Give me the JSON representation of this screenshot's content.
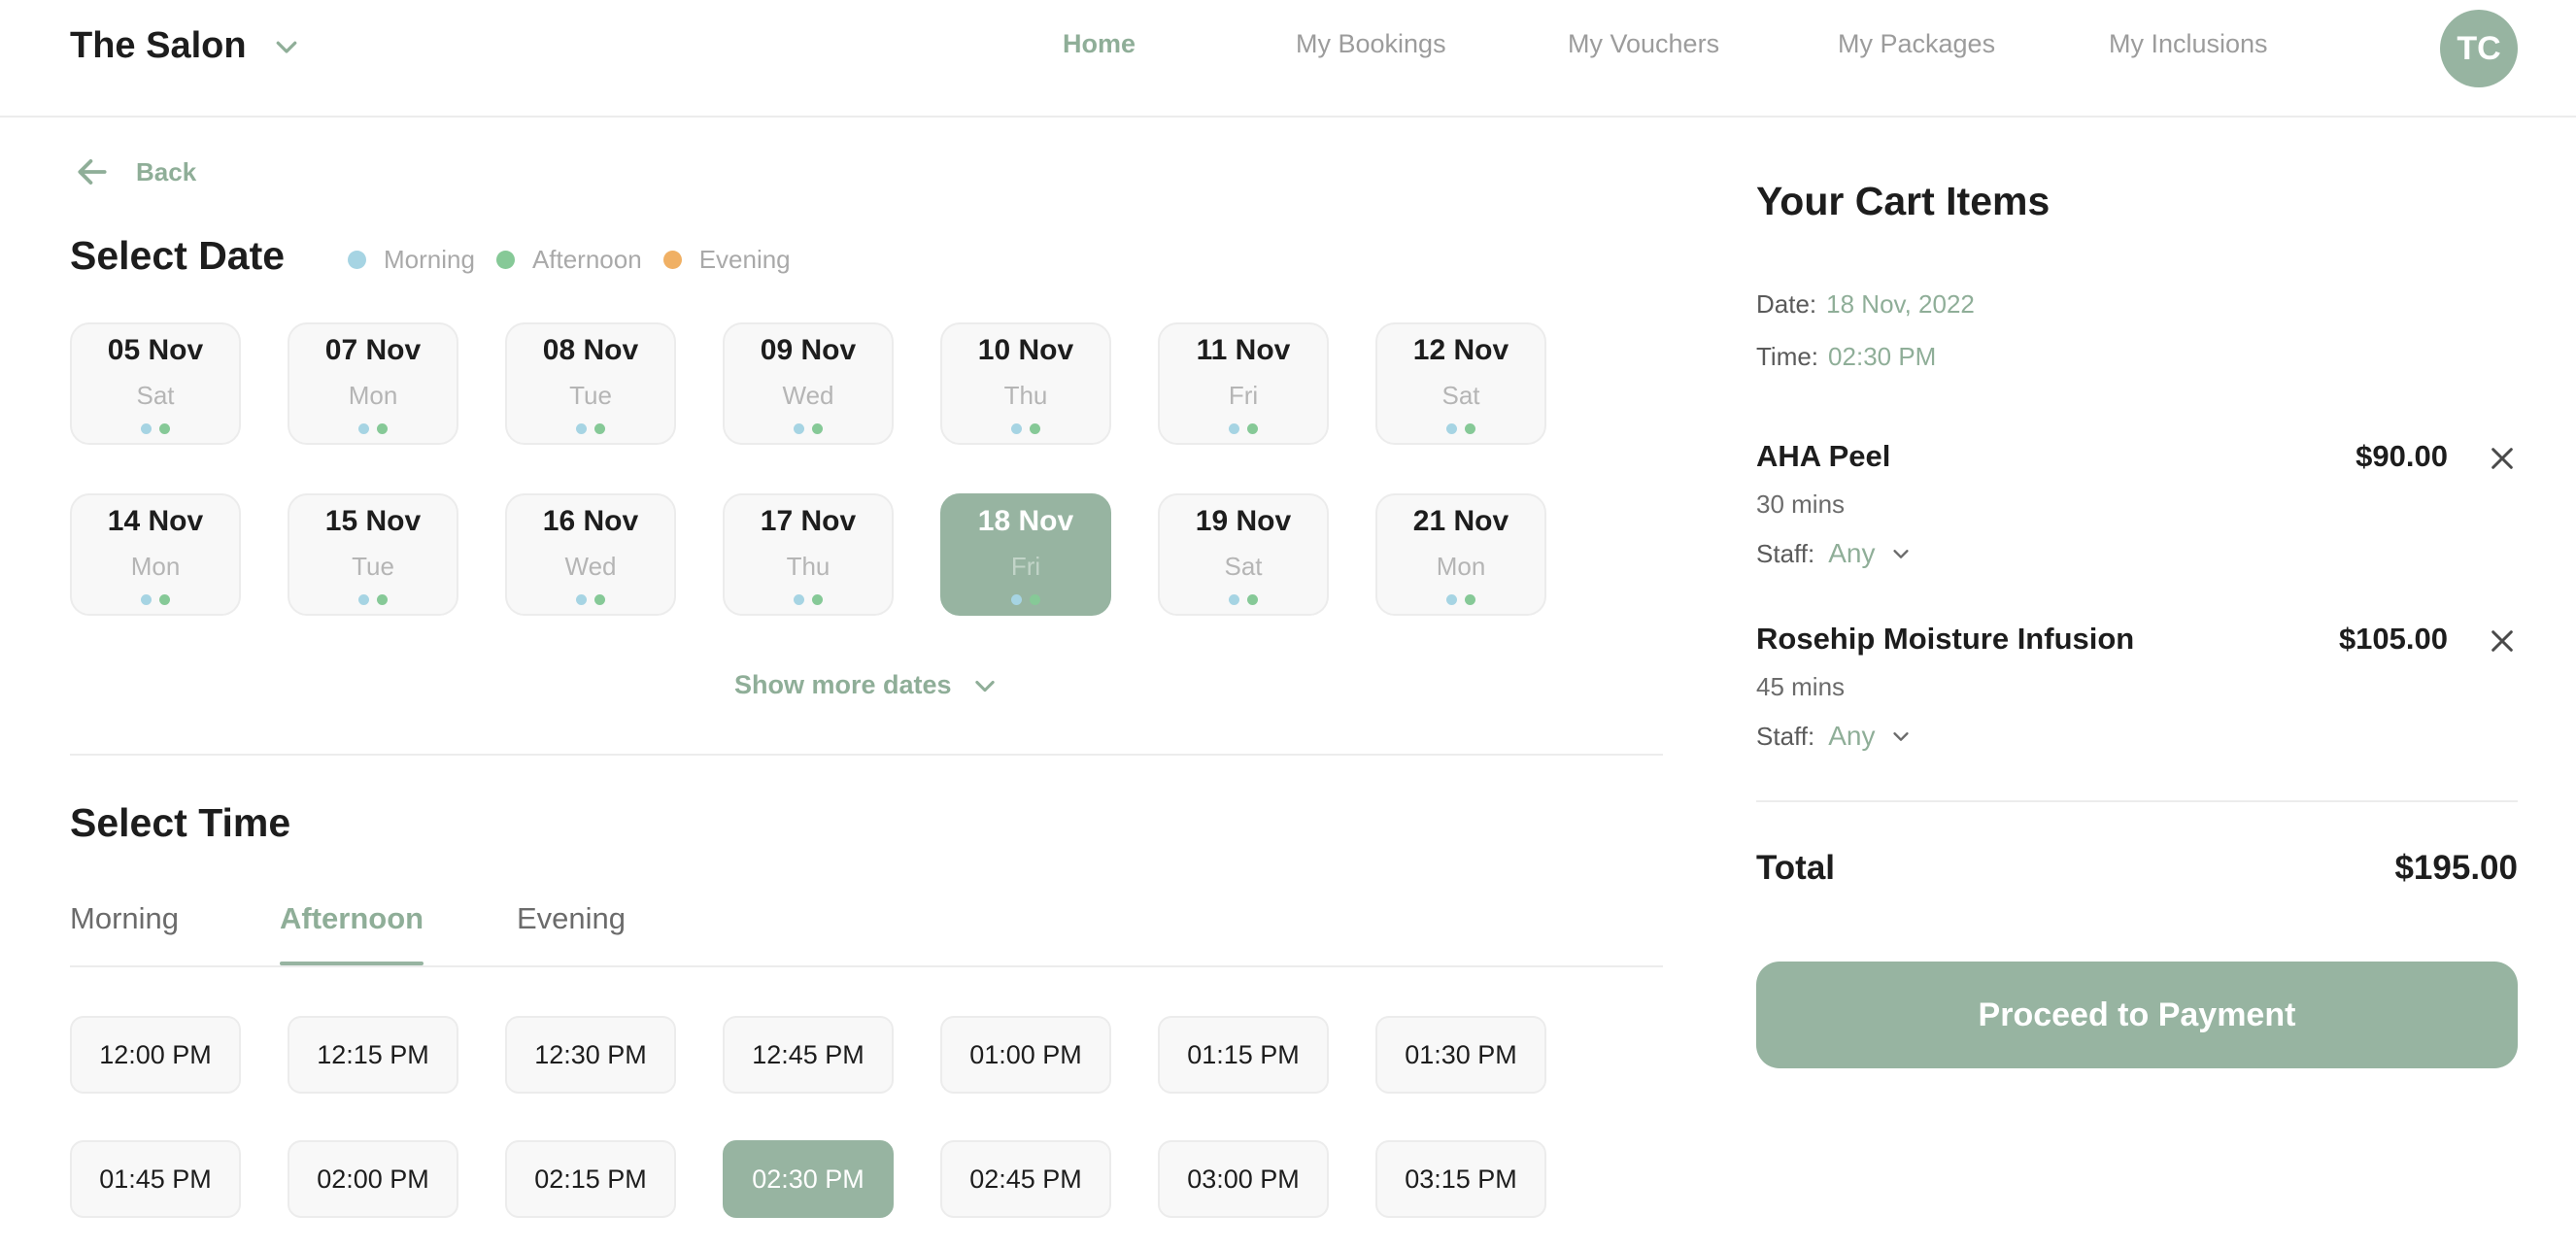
{
  "header": {
    "brand": "The Salon",
    "nav": [
      "Home",
      "My Bookings",
      "My Vouchers",
      "My Packages",
      "My Inclusions"
    ],
    "active_nav": "Home",
    "avatar_initials": "TC"
  },
  "back_label": "Back",
  "date_section": {
    "title": "Select Date",
    "legend": [
      {
        "label": "Morning",
        "color": "#a6d4e3"
      },
      {
        "label": "Afternoon",
        "color": "#86c997"
      },
      {
        "label": "Evening",
        "color": "#f0b064"
      }
    ],
    "dates": [
      {
        "day": "05 Nov",
        "weekday": "Sat"
      },
      {
        "day": "07 Nov",
        "weekday": "Mon"
      },
      {
        "day": "08 Nov",
        "weekday": "Tue"
      },
      {
        "day": "09 Nov",
        "weekday": "Wed"
      },
      {
        "day": "10 Nov",
        "weekday": "Thu"
      },
      {
        "day": "11 Nov",
        "weekday": "Fri"
      },
      {
        "day": "12 Nov",
        "weekday": "Sat"
      },
      {
        "day": "14 Nov",
        "weekday": "Mon"
      },
      {
        "day": "15 Nov",
        "weekday": "Tue"
      },
      {
        "day": "16 Nov",
        "weekday": "Wed"
      },
      {
        "day": "17 Nov",
        "weekday": "Thu"
      },
      {
        "day": "18 Nov",
        "weekday": "Fri",
        "selected": true
      },
      {
        "day": "19 Nov",
        "weekday": "Sat"
      },
      {
        "day": "21 Nov",
        "weekday": "Mon"
      }
    ],
    "show_more": "Show more dates"
  },
  "time_section": {
    "title": "Select Time",
    "tabs": [
      "Morning",
      "Afternoon",
      "Evening"
    ],
    "active_tab": "Afternoon",
    "times": [
      "12:00 PM",
      "12:15 PM",
      "12:30 PM",
      "12:45 PM",
      "01:00 PM",
      "01:15 PM",
      "01:30 PM",
      "01:45 PM",
      "02:00 PM",
      "02:15 PM",
      "02:30 PM",
      "02:45 PM",
      "03:00 PM",
      "03:15 PM"
    ],
    "selected_time": "02:30 PM"
  },
  "cart": {
    "title": "Your Cart Items",
    "date_label": "Date:",
    "date_value": "18 Nov, 2022",
    "time_label": "Time:",
    "time_value": "02:30 PM",
    "items": [
      {
        "name": "AHA Peel",
        "price": "$90.00",
        "duration": "30 mins",
        "staff_label": "Staff:",
        "staff_value": "Any"
      },
      {
        "name": "Rosehip Moisture Infusion",
        "price": "$105.00",
        "duration": "45 mins",
        "staff_label": "Staff:",
        "staff_value": "Any"
      }
    ],
    "total_label": "Total",
    "total_value": "$195.00",
    "pay_button": "Proceed to Payment"
  },
  "colors": {
    "accent": "#97b4a1",
    "accent_text": "#8fae98"
  }
}
